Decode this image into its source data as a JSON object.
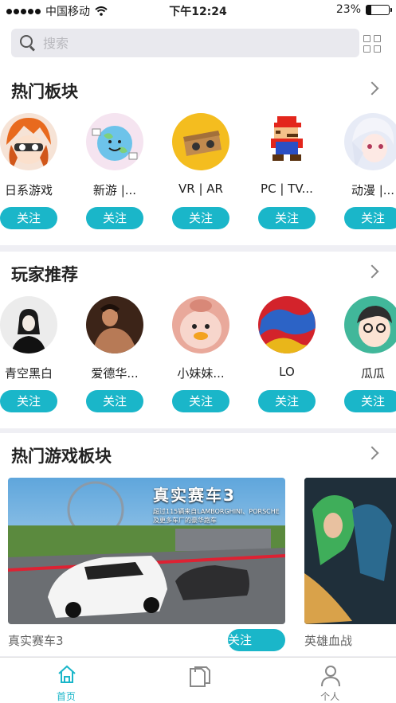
{
  "status": {
    "carrier": "中国移动",
    "time": "下午12:24",
    "battery": "23%",
    "battery_level": 0.23
  },
  "search": {
    "placeholder": "搜索"
  },
  "hot_boards": {
    "title": "热门板块",
    "items": [
      {
        "name": "日系游戏",
        "follow": "关注"
      },
      {
        "name": "新游 |...",
        "follow": "关注"
      },
      {
        "name": "VR | AR",
        "follow": "关注"
      },
      {
        "name": "PC | TV...",
        "follow": "关注"
      },
      {
        "name": "动漫 |...",
        "follow": "关注"
      }
    ]
  },
  "players": {
    "title": "玩家推荐",
    "items": [
      {
        "name": "青空黑白",
        "follow": "关注"
      },
      {
        "name": "爱德华...",
        "follow": "关注"
      },
      {
        "name": "小妹妹...",
        "follow": "关注"
      },
      {
        "name": "LO",
        "follow": "关注"
      },
      {
        "name": "瓜瓜",
        "follow": "关注"
      }
    ]
  },
  "hot_games": {
    "title": "热门游戏板块",
    "items": [
      {
        "name": "真实赛车3",
        "banner_title": "真实赛车3",
        "banner_sub1": "超过115辆来自LAMBORGHINI、PORSCHE",
        "banner_sub2": "及更多车厂的豪华跑车",
        "follow": "关注"
      },
      {
        "name": "英雄血战"
      }
    ]
  },
  "tabbar": {
    "home": "首页",
    "profile": "个人"
  },
  "colors": {
    "accent": "#1ab6c9"
  }
}
